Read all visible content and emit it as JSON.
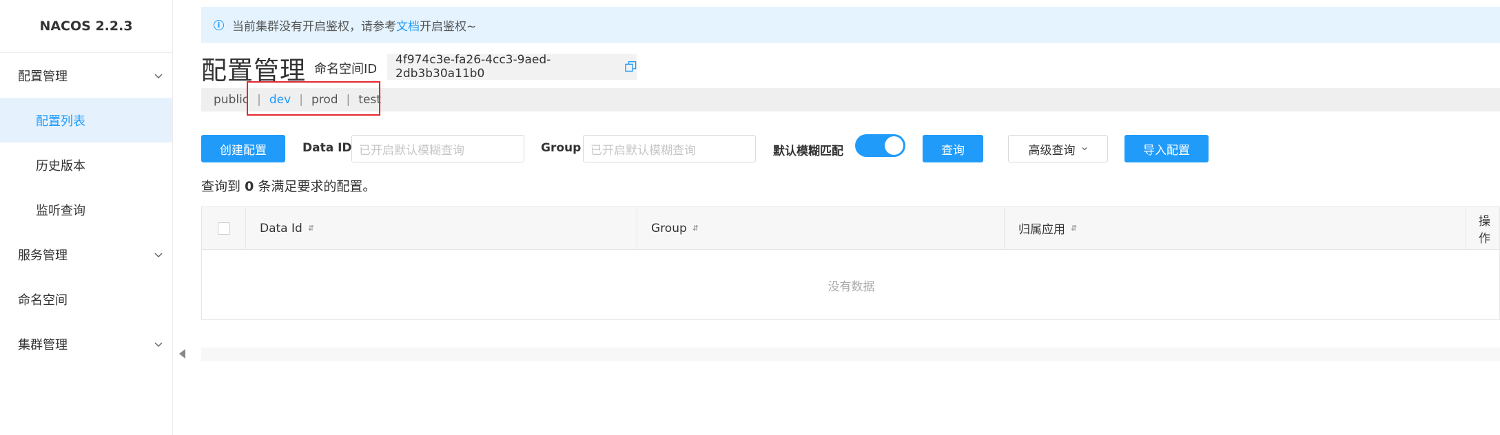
{
  "sidebar": {
    "brand": "NACOS 2.2.3",
    "groups": [
      {
        "label": "配置管理",
        "items": [
          "配置列表",
          "历史版本",
          "监听查询"
        ]
      },
      {
        "label": "服务管理"
      },
      {
        "label": "命名空间"
      },
      {
        "label": "集群管理"
      }
    ]
  },
  "notice": {
    "prefix": "当前集群没有开启鉴权，请参考",
    "link": "文档",
    "suffix": "开启鉴权~"
  },
  "header": {
    "title": "配置管理",
    "namespace_label": "命名空间ID",
    "namespace_id": "4f974c3e-fa26-4cc3-9aed-2db3b30a11b0"
  },
  "namespaces": {
    "items": [
      "public",
      "dev",
      "prod",
      "test"
    ],
    "separator": "|",
    "current": "dev"
  },
  "toolbar": {
    "create_label": "创建配置",
    "dataid_label": "Data ID",
    "dataid_placeholder": "已开启默认模糊查询",
    "group_label": "Group",
    "group_placeholder": "已开启默认模糊查询",
    "fuzzy_label": "默认模糊匹配",
    "fuzzy_enabled": true,
    "query_label": "查询",
    "advanced_label": "高级查询",
    "import_label": "导入配置"
  },
  "result": {
    "prefix": "查询到",
    "count": "0",
    "suffix": "条满足要求的配置。"
  },
  "table": {
    "columns": [
      "Data Id",
      "Group",
      "归属应用",
      "操作"
    ],
    "empty_text": "没有数据"
  },
  "colors": {
    "accent": "#209bfa",
    "highlight": "#e3262f"
  }
}
